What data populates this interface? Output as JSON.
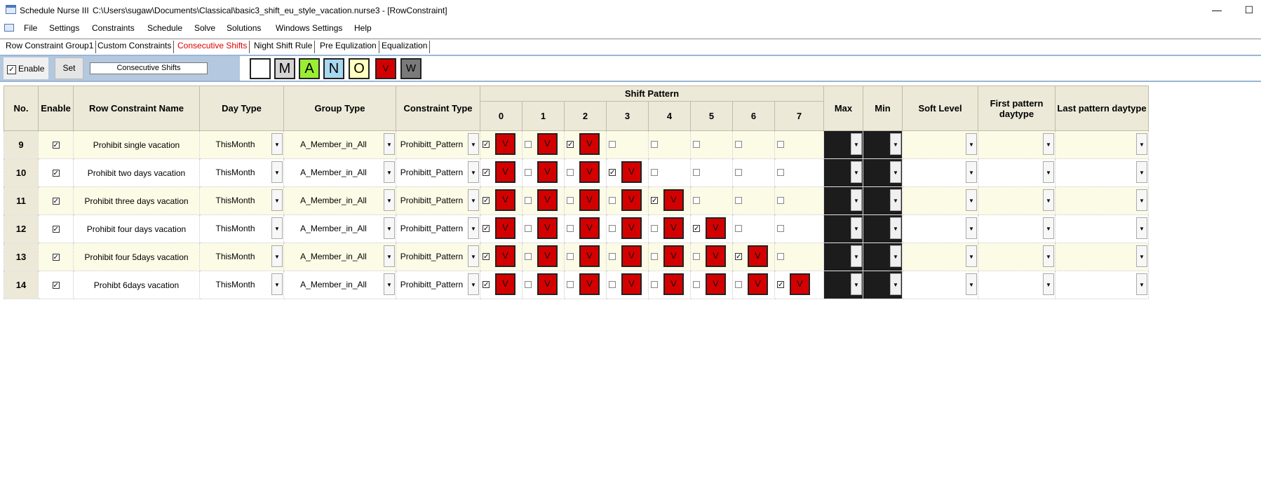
{
  "window": {
    "app_name": "Schedule Nurse III",
    "path": "C:\\Users\\sugaw\\Documents\\Classical\\basic3_shift_eu_style_vacation.nurse3 - [RowConstraint]",
    "minimize_glyph": "—",
    "maximize_glyph": "☐"
  },
  "menu": [
    "File",
    "Settings",
    "Constraints",
    "Schedule",
    "Solve",
    "Solutions",
    "Windows Settings",
    "Help"
  ],
  "tabs": [
    {
      "label": "Row Constraint Group1",
      "active": false
    },
    {
      "label": "Custom Constraints",
      "active": false
    },
    {
      "label": "Consecutive Shifts",
      "active": true
    },
    {
      "label": "Night Shift Rule",
      "active": false
    },
    {
      "label": "Pre Equlization",
      "active": false
    },
    {
      "label": "Equalization",
      "active": false
    }
  ],
  "toolbar": {
    "enable_label": "Enable",
    "enable_checked": "✓",
    "set_label": "Set",
    "name_value": "Consecutive Shifts",
    "shift_buttons": [
      {
        "label": "",
        "color": "#ffffff"
      },
      {
        "label": "M",
        "color": "#d4d4d4"
      },
      {
        "label": "A",
        "color": "#99ee33"
      },
      {
        "label": "N",
        "color": "#a8d8f0"
      },
      {
        "label": "O",
        "color": "#ffffc0"
      },
      {
        "label": "V",
        "color": "#d40000"
      },
      {
        "label": "W",
        "color": "#7a7a7a"
      }
    ]
  },
  "grid": {
    "headers": {
      "no": "No.",
      "enable": "Enable",
      "name": "Row Constraint Name",
      "day_type": "Day Type",
      "group_type": "Group Type",
      "constraint_type": "Constraint Type",
      "shift_pattern": "Shift Pattern",
      "pattern_cols": [
        "0",
        "1",
        "2",
        "3",
        "4",
        "5",
        "6",
        "7"
      ],
      "max": "Max",
      "min": "Min",
      "soft_level": "Soft Level",
      "first_pattern_daytype": "First pattern daytype",
      "last_pattern_daytype": "Last pattern daytype"
    },
    "check_glyph": "✓",
    "dropdown_glyph": "▼",
    "rows": [
      {
        "no": "9",
        "enabled": true,
        "name": "Prohibit single vacation",
        "day_type": "ThisMonth",
        "group_type": "A_Member_in_All",
        "constraint_type": "Prohibitt_Pattern",
        "pattern": [
          {
            "checked": true,
            "shift": "V"
          },
          {
            "checked": false,
            "shift": "V"
          },
          {
            "checked": true,
            "shift": "V"
          },
          {
            "checked": false,
            "shift": ""
          },
          {
            "checked": false,
            "shift": ""
          },
          {
            "checked": false,
            "shift": ""
          },
          {
            "checked": false,
            "shift": ""
          },
          {
            "checked": false,
            "shift": ""
          }
        ]
      },
      {
        "no": "10",
        "enabled": true,
        "name": "Prohibit two days vacation",
        "day_type": "ThisMonth",
        "group_type": "A_Member_in_All",
        "constraint_type": "Prohibitt_Pattern",
        "pattern": [
          {
            "checked": true,
            "shift": "V"
          },
          {
            "checked": false,
            "shift": "V"
          },
          {
            "checked": false,
            "shift": "V"
          },
          {
            "checked": true,
            "shift": "V"
          },
          {
            "checked": false,
            "shift": ""
          },
          {
            "checked": false,
            "shift": ""
          },
          {
            "checked": false,
            "shift": ""
          },
          {
            "checked": false,
            "shift": ""
          }
        ]
      },
      {
        "no": "11",
        "enabled": true,
        "name": "Prohibit three days vacation",
        "day_type": "ThisMonth",
        "group_type": "A_Member_in_All",
        "constraint_type": "Prohibitt_Pattern",
        "pattern": [
          {
            "checked": true,
            "shift": "V"
          },
          {
            "checked": false,
            "shift": "V"
          },
          {
            "checked": false,
            "shift": "V"
          },
          {
            "checked": false,
            "shift": "V"
          },
          {
            "checked": true,
            "shift": "V"
          },
          {
            "checked": false,
            "shift": ""
          },
          {
            "checked": false,
            "shift": ""
          },
          {
            "checked": false,
            "shift": ""
          }
        ]
      },
      {
        "no": "12",
        "enabled": true,
        "name": "Prohibit four days vacation",
        "day_type": "ThisMonth",
        "group_type": "A_Member_in_All",
        "constraint_type": "Prohibitt_Pattern",
        "pattern": [
          {
            "checked": true,
            "shift": "V"
          },
          {
            "checked": false,
            "shift": "V"
          },
          {
            "checked": false,
            "shift": "V"
          },
          {
            "checked": false,
            "shift": "V"
          },
          {
            "checked": false,
            "shift": "V"
          },
          {
            "checked": true,
            "shift": "V"
          },
          {
            "checked": false,
            "shift": ""
          },
          {
            "checked": false,
            "shift": ""
          }
        ]
      },
      {
        "no": "13",
        "enabled": true,
        "name": "Prohibit four 5days vacation",
        "day_type": "ThisMonth",
        "group_type": "A_Member_in_All",
        "constraint_type": "Prohibitt_Pattern",
        "pattern": [
          {
            "checked": true,
            "shift": "V"
          },
          {
            "checked": false,
            "shift": "V"
          },
          {
            "checked": false,
            "shift": "V"
          },
          {
            "checked": false,
            "shift": "V"
          },
          {
            "checked": false,
            "shift": "V"
          },
          {
            "checked": false,
            "shift": "V"
          },
          {
            "checked": true,
            "shift": "V"
          },
          {
            "checked": false,
            "shift": ""
          }
        ]
      },
      {
        "no": "14",
        "enabled": true,
        "name": "Prohibt 6days vacation",
        "day_type": "ThisMonth",
        "group_type": "A_Member_in_All",
        "constraint_type": "Prohibitt_Pattern",
        "pattern": [
          {
            "checked": true,
            "shift": "V"
          },
          {
            "checked": false,
            "shift": "V"
          },
          {
            "checked": false,
            "shift": "V"
          },
          {
            "checked": false,
            "shift": "V"
          },
          {
            "checked": false,
            "shift": "V"
          },
          {
            "checked": false,
            "shift": "V"
          },
          {
            "checked": false,
            "shift": "V"
          },
          {
            "checked": true,
            "shift": "V"
          }
        ]
      }
    ]
  }
}
